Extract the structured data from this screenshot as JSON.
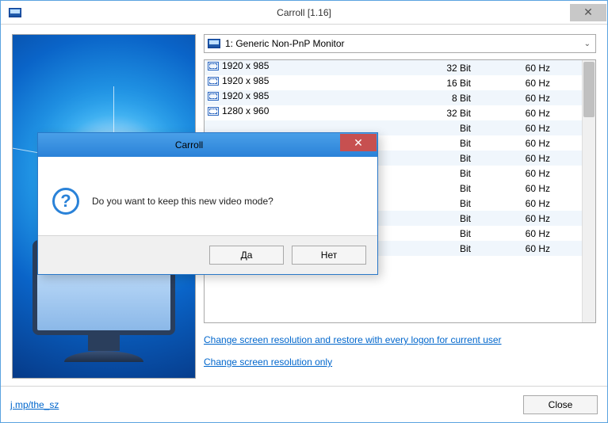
{
  "window": {
    "title": "Carroll [1.16]",
    "close_x": "✕"
  },
  "monitor_select": {
    "label": "1: Generic Non-PnP Monitor"
  },
  "resolutions": [
    {
      "res": "1920 x 985",
      "bit": "32 Bit",
      "hz": "60 Hz"
    },
    {
      "res": "1920 x 985",
      "bit": "16 Bit",
      "hz": "60 Hz"
    },
    {
      "res": "1920 x 985",
      "bit": "8 Bit",
      "hz": "60 Hz"
    },
    {
      "res": "1280 x 960",
      "bit": "32 Bit",
      "hz": "60 Hz"
    },
    {
      "res": "",
      "bit": "Bit",
      "hz": "60 Hz"
    },
    {
      "res": "",
      "bit": "Bit",
      "hz": "60 Hz"
    },
    {
      "res": "",
      "bit": "Bit",
      "hz": "60 Hz"
    },
    {
      "res": "",
      "bit": "Bit",
      "hz": "60 Hz"
    },
    {
      "res": "",
      "bit": "Bit",
      "hz": "60 Hz",
      "selected": true
    },
    {
      "res": "",
      "bit": "Bit",
      "hz": "60 Hz"
    },
    {
      "res": "",
      "bit": "Bit",
      "hz": "60 Hz"
    },
    {
      "res": "",
      "bit": "Bit",
      "hz": "60 Hz"
    },
    {
      "res": "",
      "bit": "Bit",
      "hz": "60 Hz"
    }
  ],
  "links": {
    "logon": "Change screen resolution and restore with every logon for current user",
    "only": "Change screen resolution only"
  },
  "footer": {
    "url": "j.mp/the_sz",
    "close": "Close"
  },
  "dialog": {
    "title": "Carroll",
    "close_x": "✕",
    "q": "?",
    "message": "Do you want to keep this new video mode?",
    "yes": "Да",
    "no": "Нет"
  }
}
